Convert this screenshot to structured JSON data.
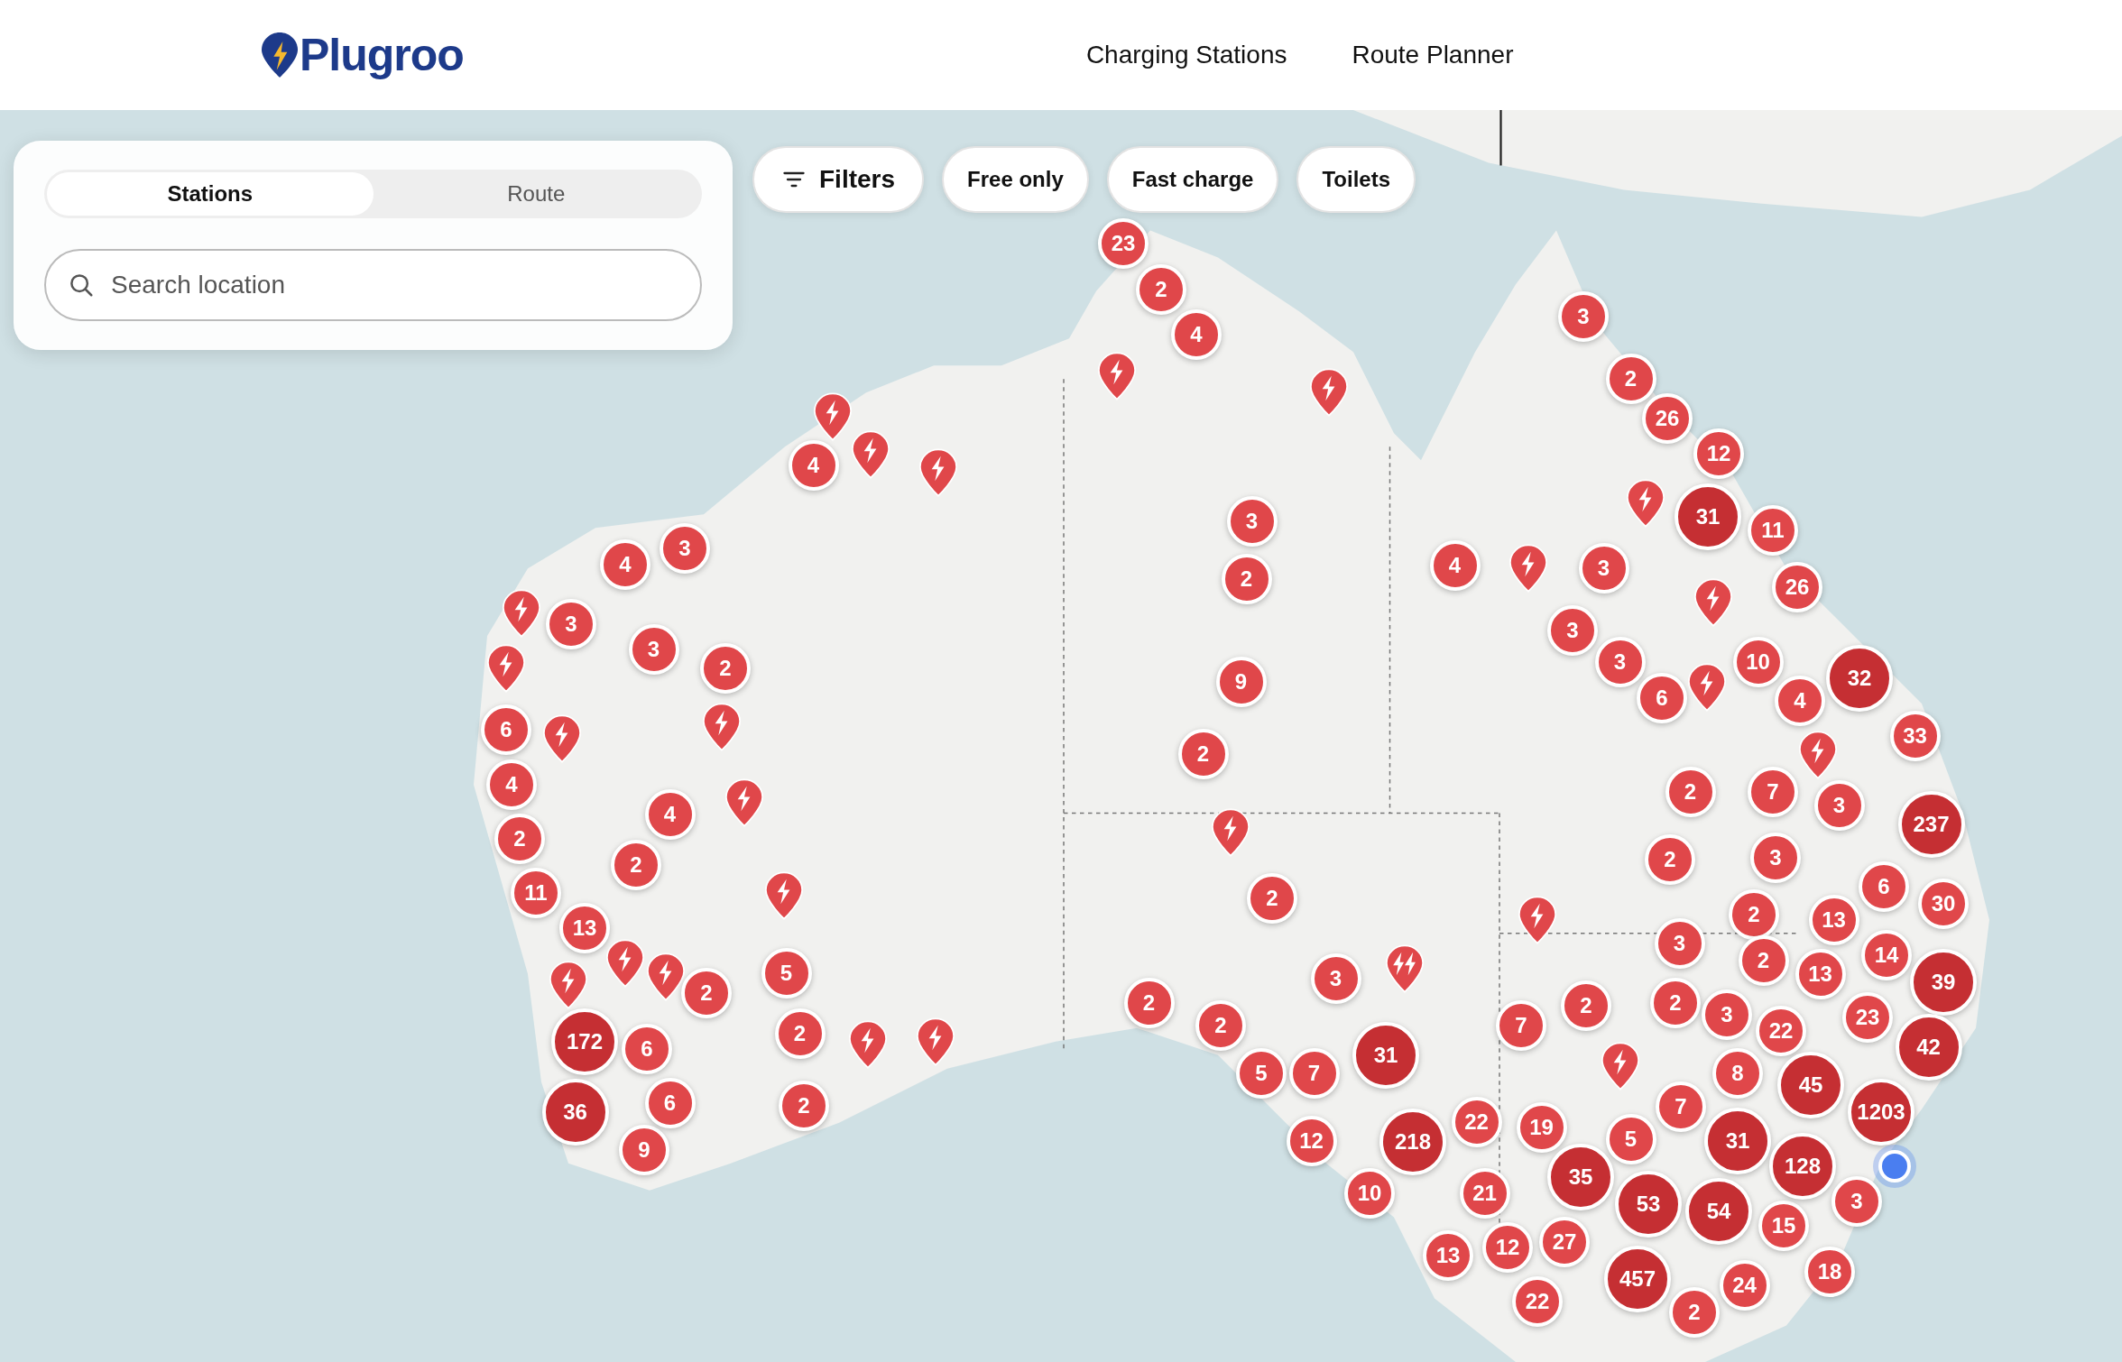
{
  "header": {
    "logo": "Plug**roo**",
    "nav": [
      "Charging Stations",
      "Route Planner"
    ]
  },
  "panel": {
    "tabs": [
      {
        "label": "Stations",
        "selected": true
      },
      {
        "label": "Route",
        "selected": false
      }
    ],
    "search": {
      "placeholder": "Search location"
    }
  },
  "filters": {
    "button": "Filters",
    "chips": [
      "Free only",
      "Fast charge",
      "Toilets"
    ]
  },
  "map": {
    "kind": "picture",
    "markers": [
      {
        "kind": "cluster",
        "count": "23"
      },
      {
        "kind": "cluster",
        "count": "2"
      },
      {
        "kind": "cluster",
        "count": "4"
      },
      {
        "kind": "cluster",
        "count": "3"
      },
      {
        "kind": "pin"
      },
      {
        "kind": "pin"
      },
      {
        "kind": "cluster",
        "count": "2"
      },
      {
        "kind": "cluster",
        "count": "4"
      },
      {
        "kind": "pin"
      },
      {
        "kind": "pin"
      },
      {
        "kind": "pin"
      },
      {
        "kind": "cluster",
        "count": "26"
      },
      {
        "kind": "cluster",
        "count": "12"
      },
      {
        "kind": "cluster",
        "count": "3"
      },
      {
        "kind": "pin"
      },
      {
        "kind": "large",
        "count": "31"
      },
      {
        "kind": "cluster",
        "count": "11"
      },
      {
        "kind": "cluster",
        "count": "4"
      },
      {
        "kind": "cluster",
        "count": "3"
      },
      {
        "kind": "cluster",
        "count": "2"
      },
      {
        "kind": "cluster",
        "count": "4"
      },
      {
        "kind": "pin"
      },
      {
        "kind": "cluster",
        "count": "3"
      },
      {
        "kind": "cluster",
        "count": "26"
      },
      {
        "kind": "pin"
      },
      {
        "kind": "cluster",
        "count": "3"
      },
      {
        "kind": "cluster",
        "count": "3"
      },
      {
        "kind": "pin"
      },
      {
        "kind": "pin"
      },
      {
        "kind": "cluster",
        "count": "3"
      },
      {
        "kind": "cluster",
        "count": "2"
      },
      {
        "kind": "cluster",
        "count": "9"
      },
      {
        "kind": "cluster",
        "count": "3"
      },
      {
        "kind": "cluster",
        "count": "6"
      },
      {
        "kind": "pin"
      },
      {
        "kind": "cluster",
        "count": "10"
      },
      {
        "kind": "cluster",
        "count": "4"
      },
      {
        "kind": "large",
        "count": "32"
      },
      {
        "kind": "cluster",
        "count": "6"
      },
      {
        "kind": "pin"
      },
      {
        "kind": "pin"
      },
      {
        "kind": "cluster",
        "count": "2"
      },
      {
        "kind": "pin"
      },
      {
        "kind": "cluster",
        "count": "33"
      },
      {
        "kind": "cluster",
        "count": "4"
      },
      {
        "kind": "cluster",
        "count": "4"
      },
      {
        "kind": "pin"
      },
      {
        "kind": "pin"
      },
      {
        "kind": "cluster",
        "count": "2"
      },
      {
        "kind": "cluster",
        "count": "7"
      },
      {
        "kind": "cluster",
        "count": "3"
      },
      {
        "kind": "large",
        "count": "237"
      },
      {
        "kind": "cluster",
        "count": "2"
      },
      {
        "kind": "cluster",
        "count": "2"
      },
      {
        "kind": "cluster",
        "count": "2"
      },
      {
        "kind": "cluster",
        "count": "3"
      },
      {
        "kind": "cluster",
        "count": "11"
      },
      {
        "kind": "pin"
      },
      {
        "kind": "cluster",
        "count": "2"
      },
      {
        "kind": "pin"
      },
      {
        "kind": "cluster",
        "count": "2"
      },
      {
        "kind": "cluster",
        "count": "13"
      },
      {
        "kind": "cluster",
        "count": "6"
      },
      {
        "kind": "cluster",
        "count": "30"
      },
      {
        "kind": "pin"
      },
      {
        "kind": "cluster",
        "count": "13"
      },
      {
        "kind": "pin"
      },
      {
        "kind": "pin"
      },
      {
        "kind": "cluster",
        "count": "5"
      },
      {
        "kind": "cluster",
        "count": "3"
      },
      {
        "kind": "double-pin"
      },
      {
        "kind": "cluster",
        "count": "3"
      },
      {
        "kind": "cluster",
        "count": "2"
      },
      {
        "kind": "cluster",
        "count": "13"
      },
      {
        "kind": "cluster",
        "count": "14"
      },
      {
        "kind": "large",
        "count": "39"
      },
      {
        "kind": "cluster",
        "count": "2"
      },
      {
        "kind": "cluster",
        "count": "2"
      },
      {
        "kind": "cluster",
        "count": "2"
      },
      {
        "kind": "cluster",
        "count": "2"
      },
      {
        "kind": "cluster",
        "count": "7"
      },
      {
        "kind": "cluster",
        "count": "2"
      },
      {
        "kind": "cluster",
        "count": "2"
      },
      {
        "kind": "cluster",
        "count": "3"
      },
      {
        "kind": "cluster",
        "count": "22"
      },
      {
        "kind": "cluster",
        "count": "23"
      },
      {
        "kind": "large",
        "count": "172"
      },
      {
        "kind": "cluster",
        "count": "6"
      },
      {
        "kind": "pin"
      },
      {
        "kind": "pin"
      },
      {
        "kind": "cluster",
        "count": "5"
      },
      {
        "kind": "cluster",
        "count": "7"
      },
      {
        "kind": "large",
        "count": "31"
      },
      {
        "kind": "pin"
      },
      {
        "kind": "cluster",
        "count": "8"
      },
      {
        "kind": "large",
        "count": "45"
      },
      {
        "kind": "large",
        "count": "42"
      },
      {
        "kind": "large",
        "count": "36"
      },
      {
        "kind": "cluster",
        "count": "9"
      },
      {
        "kind": "cluster",
        "count": "6"
      },
      {
        "kind": "cluster",
        "count": "2"
      },
      {
        "kind": "cluster",
        "count": "12"
      },
      {
        "kind": "large",
        "count": "218"
      },
      {
        "kind": "cluster",
        "count": "22"
      },
      {
        "kind": "cluster",
        "count": "19"
      },
      {
        "kind": "cluster",
        "count": "5"
      },
      {
        "kind": "cluster",
        "count": "7"
      },
      {
        "kind": "large",
        "count": "31"
      },
      {
        "kind": "large",
        "count": "1203"
      },
      {
        "kind": "cluster",
        "count": "10"
      },
      {
        "kind": "cluster",
        "count": "21"
      },
      {
        "kind": "large",
        "count": "35"
      },
      {
        "kind": "large",
        "count": "53"
      },
      {
        "kind": "large",
        "count": "54"
      },
      {
        "kind": "cluster",
        "count": "15"
      },
      {
        "kind": "large",
        "count": "128"
      },
      {
        "kind": "cluster",
        "count": "3"
      },
      {
        "kind": "location"
      },
      {
        "kind": "cluster",
        "count": "13"
      },
      {
        "kind": "cluster",
        "count": "12"
      },
      {
        "kind": "cluster",
        "count": "27"
      },
      {
        "kind": "large",
        "count": "457"
      },
      {
        "kind": "cluster",
        "count": "18"
      },
      {
        "kind": "cluster",
        "count": "22"
      },
      {
        "kind": "cluster",
        "count": "2"
      },
      {
        "kind": "cluster",
        "count": "24"
      }
    ]
  }
}
